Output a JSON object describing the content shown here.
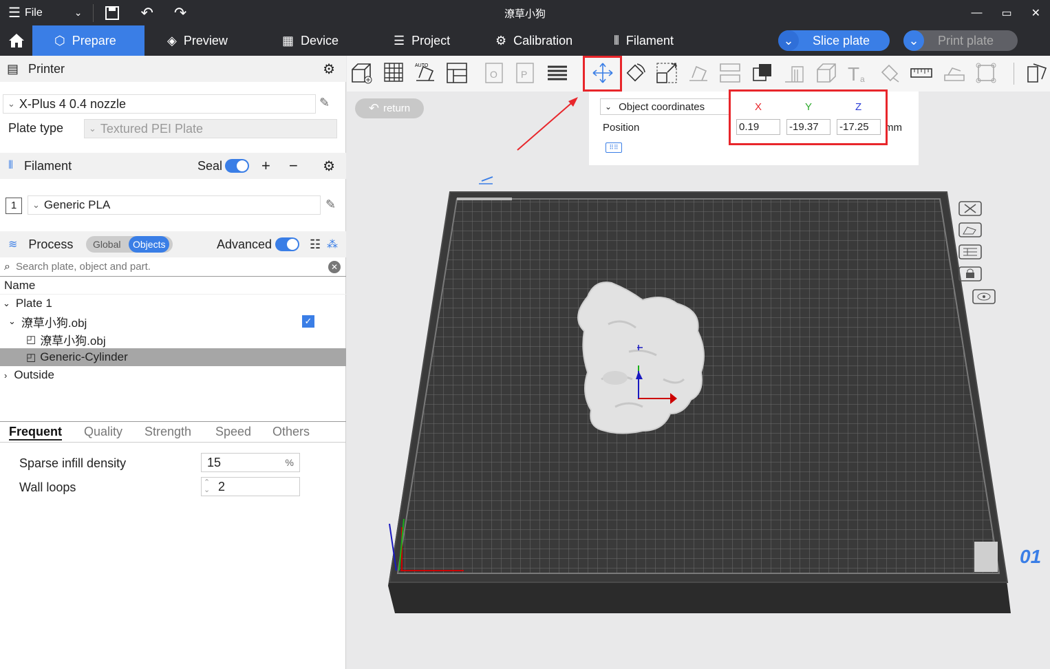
{
  "title": "潦草小狗",
  "menu": {
    "file": "File"
  },
  "tabs": {
    "prepare": "Prepare",
    "preview": "Preview",
    "device": "Device",
    "project": "Project",
    "calibration": "Calibration",
    "filament": "Filament"
  },
  "actions": {
    "slice": "Slice plate",
    "print": "Print plate"
  },
  "printer": {
    "section": "Printer",
    "name": "X-Plus 4 0.4 nozzle",
    "plate_type_label": "Plate type",
    "plate_type": "Textured PEI Plate"
  },
  "filament": {
    "section": "Filament",
    "seal_label": "Seal",
    "slot": "1",
    "name": "Generic PLA"
  },
  "process": {
    "section": "Process",
    "global": "Global",
    "objects": "Objects",
    "advanced": "Advanced"
  },
  "search": {
    "placeholder": "Search plate, object and part."
  },
  "tree": {
    "header": "Name",
    "plate": "Plate 1",
    "object": "潦草小狗.obj",
    "part": "潦草小狗.obj",
    "modifier": "Generic-Cylinder",
    "outside": "Outside"
  },
  "settings_tabs": [
    "Frequent",
    "Quality",
    "Strength",
    "Speed",
    "Others"
  ],
  "settings": {
    "infill_label": "Sparse infill density",
    "infill_value": "15",
    "infill_unit": "%",
    "walls_label": "Wall loops",
    "walls_value": "2"
  },
  "viewport": {
    "return": "return",
    "plate_number": "01"
  },
  "move_panel": {
    "coord_mode": "Object coordinates",
    "x": "X",
    "y": "Y",
    "z": "Z",
    "position_label": "Position",
    "x_value": "0.19",
    "y_value": "-19.37",
    "z_value": "-17.25",
    "unit": "mm"
  },
  "colors": {
    "accent": "#3a7ee6",
    "highlight": "#e8262b",
    "titlebar": "#2b2c30"
  }
}
